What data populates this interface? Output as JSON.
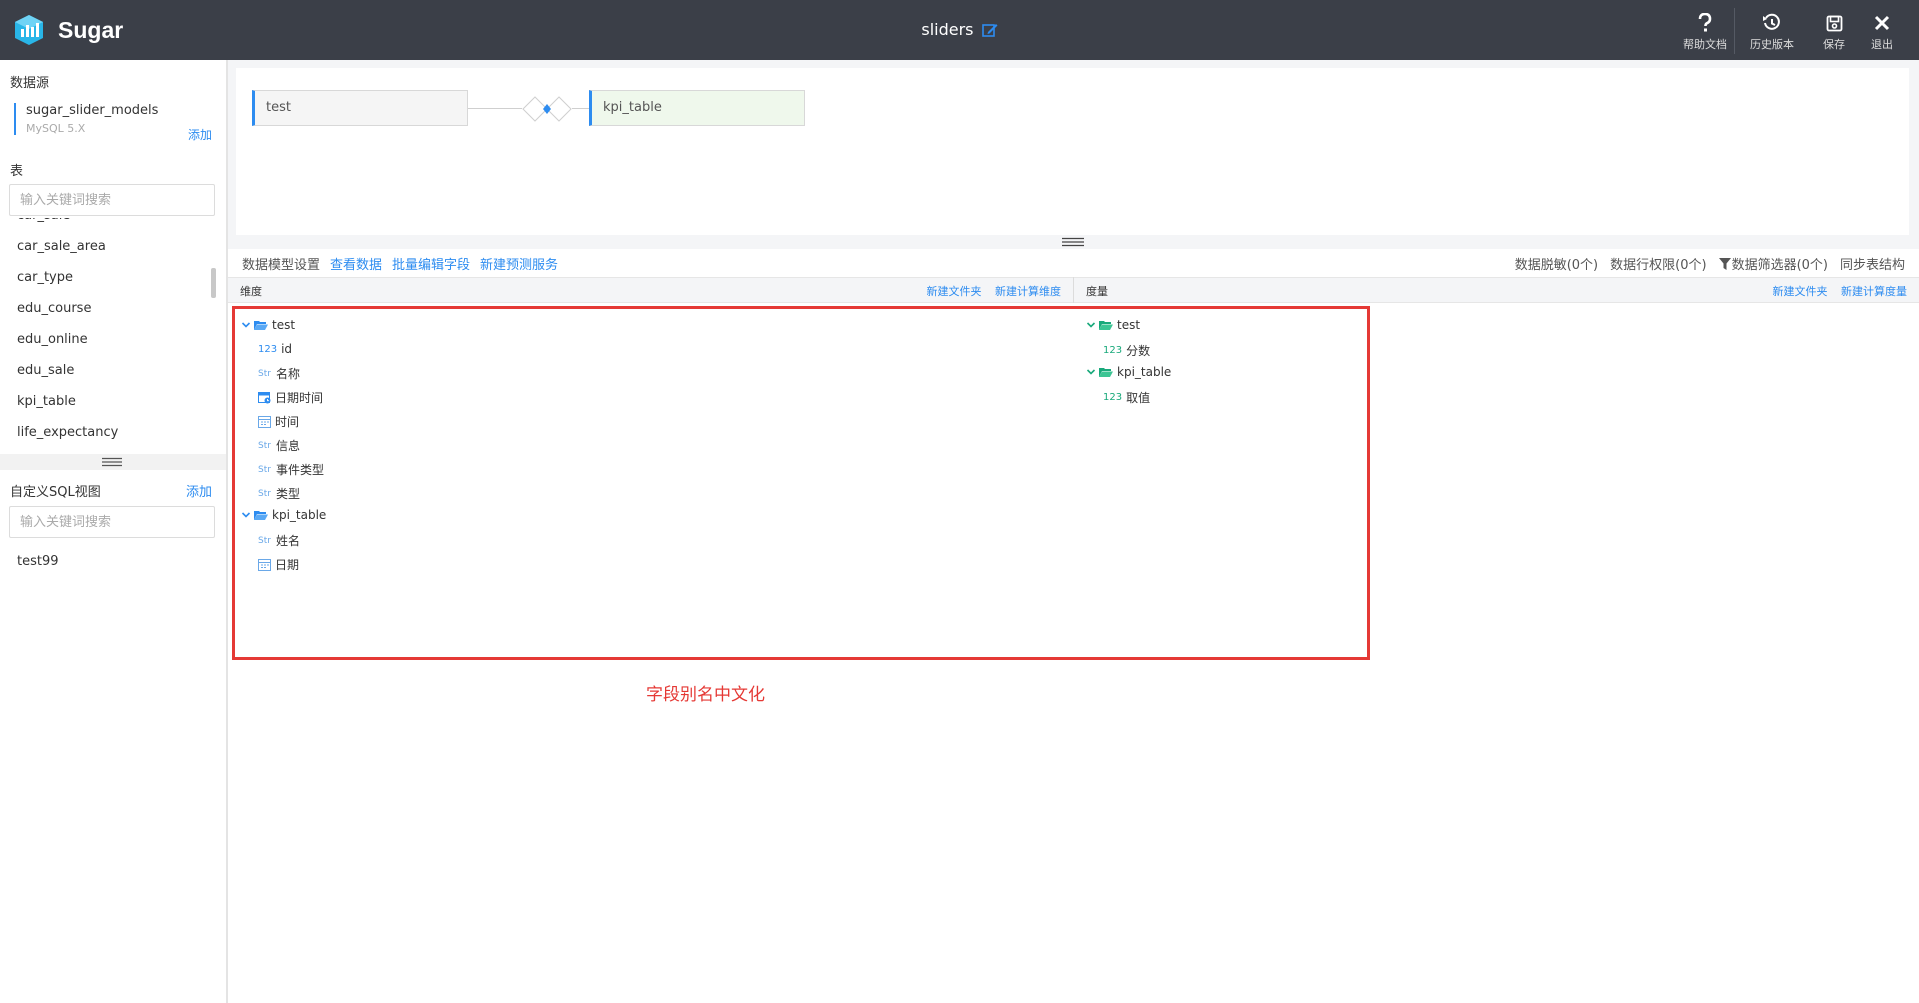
{
  "header": {
    "brand": "Sugar",
    "title": "sliders",
    "tools": [
      {
        "label": "帮助文档",
        "icon": "help-icon"
      },
      {
        "label": "历史版本",
        "icon": "history-icon"
      },
      {
        "label": "保存",
        "icon": "save-icon"
      },
      {
        "label": "退出",
        "icon": "close-icon"
      }
    ]
  },
  "sidebar": {
    "datasource_title": "数据源",
    "datasource": {
      "name": "sugar_slider_models",
      "type": "MySQL 5.X",
      "add": "添加"
    },
    "tables_title": "表",
    "table_search_placeholder": "输入关键词搜索",
    "tables": [
      "car_sale",
      "car_sale_area",
      "car_type",
      "edu_course",
      "edu_online",
      "edu_sale",
      "kpi_table",
      "life_expectancy"
    ],
    "sql_title": "自定义SQL视图",
    "sql_add": "添加",
    "sql_search_placeholder": "输入关键词搜索",
    "sql_views": [
      "test99"
    ]
  },
  "canvas": {
    "left_table": "test",
    "right_table": "kpi_table"
  },
  "toolbar": {
    "left": {
      "setting": "数据模型设置",
      "view_data": "查看数据",
      "batch_edit": "批量编辑字段",
      "new_predict": "新建预测服务"
    },
    "right": {
      "masking": "数据脱敏(0个)",
      "row_perm": "数据行权限(0个)",
      "filter": "数据筛选器(0个)",
      "sync": "同步表结构"
    }
  },
  "dimensions": {
    "title": "维度",
    "new_folder": "新建文件夹",
    "new_calc": "新建计算维度",
    "groups": [
      {
        "name": "test",
        "fields": [
          {
            "type": "123",
            "name": "id"
          },
          {
            "type": "Str",
            "name": "名称"
          },
          {
            "type": "datetime",
            "name": "日期时间"
          },
          {
            "type": "date",
            "name": "时间"
          },
          {
            "type": "Str",
            "name": "信息"
          },
          {
            "type": "Str",
            "name": "事件类型"
          },
          {
            "type": "Str",
            "name": "类型"
          }
        ]
      },
      {
        "name": "kpi_table",
        "fields": [
          {
            "type": "Str",
            "name": "姓名"
          },
          {
            "type": "date",
            "name": "日期"
          }
        ]
      }
    ]
  },
  "measures": {
    "title": "度量",
    "new_folder": "新建文件夹",
    "new_calc": "新建计算度量",
    "groups": [
      {
        "name": "test",
        "fields": [
          {
            "type": "123",
            "name": "分数"
          }
        ]
      },
      {
        "name": "kpi_table",
        "fields": [
          {
            "type": "123",
            "name": "取值"
          }
        ]
      }
    ]
  },
  "annotation": "字段别名中文化",
  "colors": {
    "accent": "#2d8cf0",
    "header_bg": "#3b3f48",
    "annotation": "#e53935",
    "measure": "#19a97b"
  }
}
